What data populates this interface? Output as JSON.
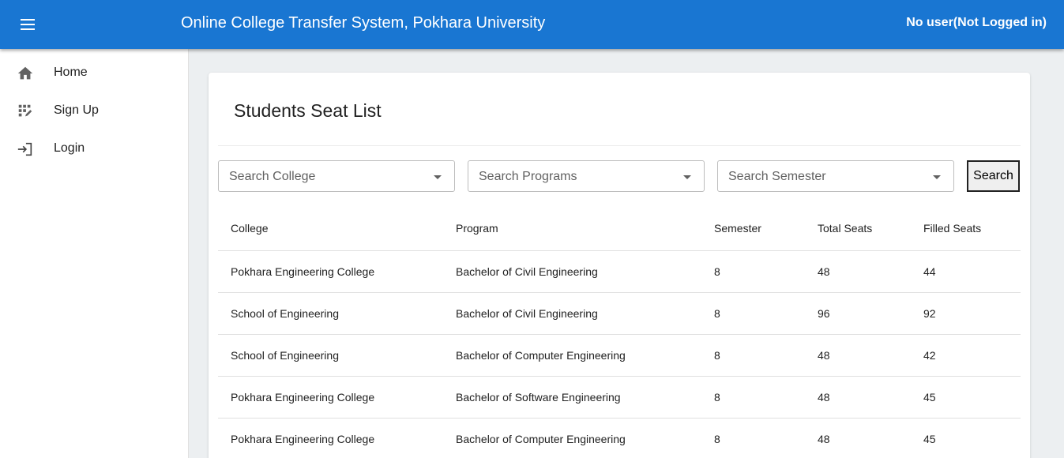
{
  "header": {
    "menu_icon": "menu-icon",
    "title": "Online College Transfer System, Pokhara University",
    "user_status": "No user(Not Logged in)",
    "bg_color": "#1976d2"
  },
  "sidebar": {
    "items": [
      {
        "label": "Home",
        "icon": "home-icon"
      },
      {
        "label": "Sign Up",
        "icon": "signup-icon"
      },
      {
        "label": "Login",
        "icon": "login-icon"
      }
    ]
  },
  "main": {
    "title": "Students Seat List",
    "filters": {
      "college_placeholder": "Search College",
      "programs_placeholder": "Search Programs",
      "semester_placeholder": "Search Semester",
      "search_label": "Search"
    },
    "table": {
      "headers": [
        "College",
        "Program",
        "Semester",
        "Total Seats",
        "Filled Seats"
      ],
      "rows": [
        [
          "Pokhara Engineering College",
          "Bachelor of Civil Engineering",
          "8",
          "48",
          "44"
        ],
        [
          "School of Engineering",
          "Bachelor of Civil Engineering",
          "8",
          "96",
          "92"
        ],
        [
          "School of Engineering",
          "Bachelor of Computer Engineering",
          "8",
          "48",
          "42"
        ],
        [
          "Pokhara Engineering College",
          "Bachelor of Software Engineering",
          "8",
          "48",
          "45"
        ],
        [
          "Pokhara Engineering College",
          "Bachelor of Computer Engineering",
          "8",
          "48",
          "45"
        ]
      ]
    }
  }
}
